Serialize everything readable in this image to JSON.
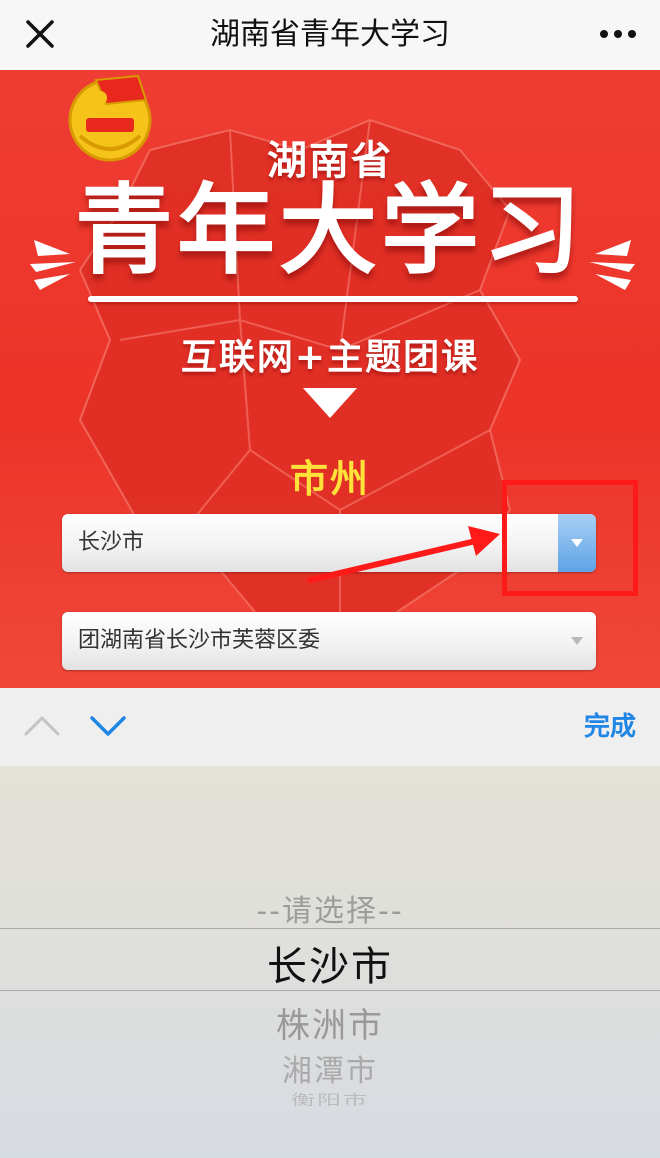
{
  "nav": {
    "title": "湖南省青年大学习"
  },
  "hero": {
    "province": "湖南省",
    "main_title": "青年大学习",
    "subtitle": "互联网+主题团课",
    "city_label": "市州"
  },
  "form": {
    "city_select_value": "长沙市",
    "org_select_value": "团湖南省长沙市芙蓉区委"
  },
  "accessory": {
    "done_label": "完成"
  },
  "picker": {
    "options": [
      "--请选择--",
      "长沙市",
      "株洲市",
      "湘潭市",
      "衡阳市"
    ],
    "selected_index": 1
  },
  "colors": {
    "hero_red": "#ec3328",
    "city_label_yellow": "#ffe23a",
    "done_blue": "#1f86e6",
    "annotation_red": "#ff1a1a"
  }
}
